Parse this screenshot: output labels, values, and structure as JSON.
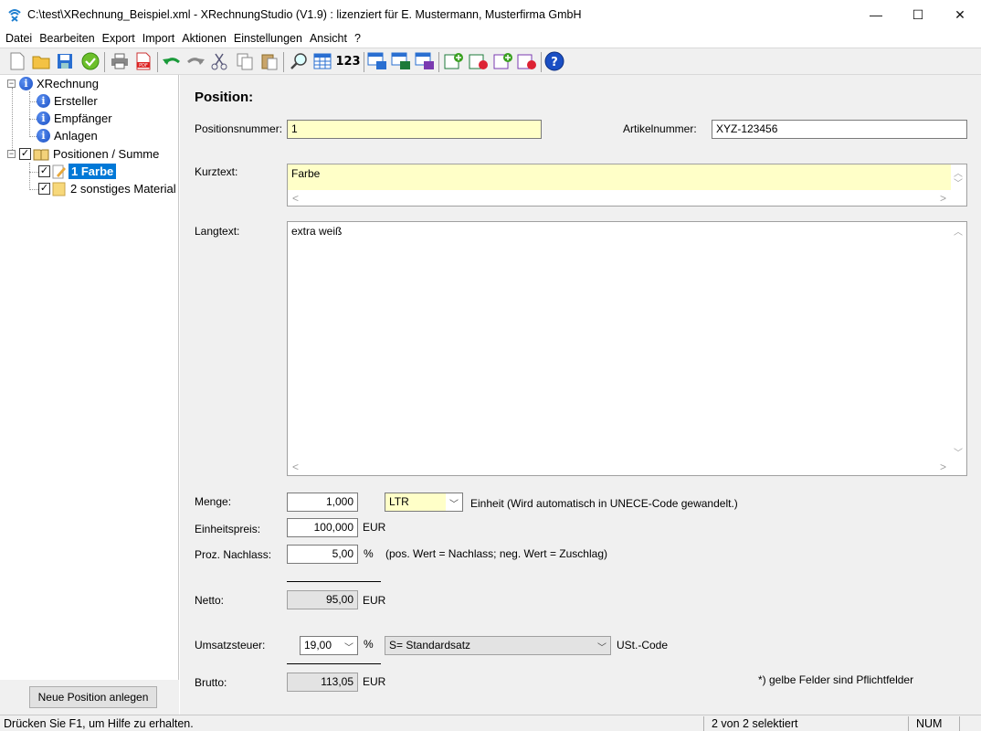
{
  "window": {
    "title": "C:\\test\\XRechnung_Beispiel.xml - XRechnungStudio (V1.9) : lizenziert für E. Mustermann, Musterfirma GmbH",
    "minimize": "—",
    "maximize": "☐",
    "close": "✕"
  },
  "menu": [
    "Datei",
    "Bearbeiten",
    "Export",
    "Import",
    "Aktionen",
    "Einstellungen",
    "Ansicht",
    "?"
  ],
  "toolbar_icons": [
    "new-doc-icon",
    "open-folder-icon",
    "save-icon",
    "check-icon",
    "print-icon",
    "pdf-icon",
    "undo-icon",
    "redo-icon",
    "cut-icon",
    "copy-icon",
    "paste-icon",
    "search-icon",
    "table-icon",
    "number-format-icon",
    "export-icon",
    "export-excel-icon",
    "export-text-icon",
    "add-row-icon",
    "refresh-row-icon",
    "add-text-icon",
    "refresh-text-icon",
    "help-icon"
  ],
  "toolbar_text": {
    "numbers": "123"
  },
  "tree": {
    "root": "XRechnung",
    "items": [
      "Ersteller",
      "Empfänger",
      "Anlagen"
    ],
    "positions_root": "Positionen / Summe",
    "positions": [
      "1 Farbe",
      "2 sonstiges Material"
    ]
  },
  "left_button": "Neue Position anlegen",
  "form": {
    "heading": "Position:",
    "positionsnummer_label": "Positionsnummer:",
    "positionsnummer": "1",
    "artikelnummer_label": "Artikelnummer:",
    "artikelnummer": "XYZ-123456",
    "kurztext_label": "Kurztext:",
    "kurztext": "Farbe",
    "langtext_label": "Langtext:",
    "langtext": "extra weiß",
    "menge_label": "Menge:",
    "menge": "1,000",
    "einheit": "LTR",
    "einheit_hint": "Einheit (Wird automatisch in UNECE-Code gewandelt.)",
    "einheitspreis_label": "Einheitspreis:",
    "einheitspreis": "100,000",
    "currency": "EUR",
    "nachlass_label": "Proz. Nachlass:",
    "nachlass": "5,00",
    "percent": "%",
    "nachlass_hint": "(pos. Wert = Nachlass; neg. Wert = Zuschlag)",
    "netto_label": "Netto:",
    "netto": "95,00",
    "ust_label": "Umsatzsteuer:",
    "ust": "19,00",
    "ust_code": "S= Standardsatz",
    "ust_code_label": "USt.-Code",
    "brutto_label": "Brutto:",
    "brutto": "113,05",
    "footnote": "*) gelbe Felder sind Pflichtfelder"
  },
  "status": {
    "help": "Drücken Sie F1, um Hilfe zu erhalten.",
    "selection": "2 von 2 selektiert",
    "num": "NUM"
  },
  "colors": {
    "required_field": "#ffffc8",
    "selection": "#0078d7",
    "pane_bg": "#f0f0f0"
  }
}
